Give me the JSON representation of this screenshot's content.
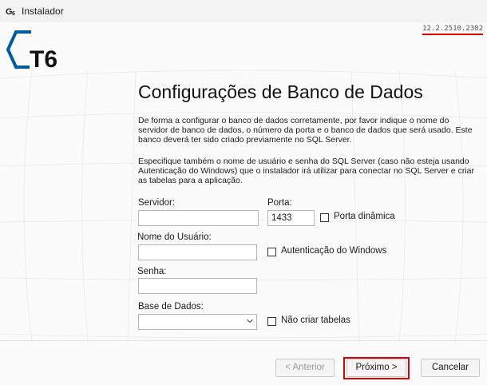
{
  "window": {
    "title": "Instalador",
    "app_icon": "t6-icon"
  },
  "version": "12.2.2510.2302",
  "logo": {
    "text": "T6"
  },
  "heading": "Configurações de Banco de Dados",
  "paragraphs": [
    "De forma a configurar o banco de dados corretamente, por favor indique o nome do servidor de banco de dados, o número da porta e o banco de dados que será usado. Este banco deverá ter sido criado previamente no SQL Server.",
    "Especifique também o nome de usuário e senha do SQL Server (caso não esteja usando Autenticação do Windows) que o instalador irá utilizar para conectar no SQL Server e criar as tabelas para a aplicação."
  ],
  "form": {
    "server_label": "Servidor:",
    "server_value": "",
    "port_label": "Porta:",
    "port_value": "1433",
    "dynamic_port_label": "Porta dinâmica",
    "dynamic_port_checked": false,
    "username_label": "Nome do Usuário:",
    "username_value": "",
    "windows_auth_label": "Autenticação do Windows",
    "windows_auth_checked": false,
    "password_label": "Senha:",
    "password_value": "",
    "database_label": "Base de Dados:",
    "database_value": "",
    "no_create_tables_label": "Não criar tabelas",
    "no_create_tables_checked": false
  },
  "buttons": {
    "previous": "< Anterior",
    "next": "Próximo >",
    "cancel": "Cancelar"
  },
  "colors": {
    "highlight": "#e00000",
    "logo": "#005aa0"
  }
}
